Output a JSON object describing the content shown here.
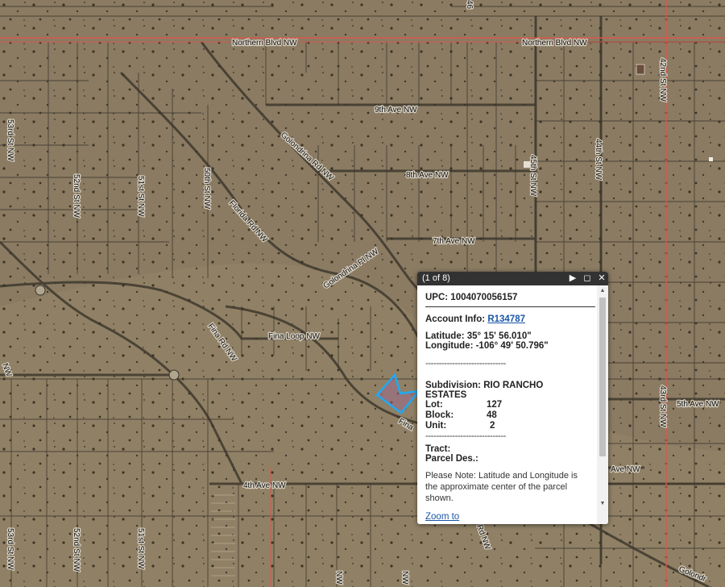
{
  "map": {
    "colors": {
      "ground": "#8a7b62",
      "grid": "#3e382e",
      "arterial": "#d9574d",
      "parcel": "#22a8f0"
    },
    "roads": {
      "northern_blvd": "Northern Blvd NW",
      "northern_blvd_2": "Northern Blvd NW",
      "ave9": "9th Ave NW",
      "ave8": "8th Ave NW",
      "ave7": "7th Ave NW",
      "ave5": "5th Ave NW",
      "ave4": "4th Ave NW",
      "golondrina_rd": "Golondrina Rd NW",
      "golondrina_pl": "Golondrina Pl NW",
      "florida_rd": "Florida Rd NW",
      "fina_loop": "Fina Loop NW",
      "fina_rd": "Fina Rd NW",
      "st53": "53rd St NW",
      "st52": "52nd St NW",
      "st51": "51st St NW",
      "st50": "50th St NW",
      "st45": "45th St NW",
      "st44": "44th St NW",
      "st43": "43rd St NW",
      "st42": "42nd St NW",
      "st53_b": "53rd St NW",
      "st52_b": "52nd St NW",
      "st51_b": "51st St NW",
      "top46": "46",
      "frag_fina": "Fina",
      "frag_ave": "Ave NW",
      "frag_rd": "Rd NW",
      "frag_nw_left": "NW",
      "frag_nw_bottom": "NW",
      "frag_golondrina": "Golondr"
    }
  },
  "popup": {
    "counter": "(1 of 8)",
    "next_icon": "next-arrow-icon",
    "maximize_icon": "maximize-icon",
    "close_icon": "close-icon",
    "title": "UPC: 1004070056157",
    "account_label": "Account Info:",
    "account_link": "R134787",
    "latitude": "Latitude: 35° 15' 56.010\"",
    "longitude": "Longitude: -106° 49' 50.796\"",
    "divider": "------------------------------",
    "subdivision_line1": "Subdivision: RIO RANCHO",
    "subdivision_line2": "ESTATES",
    "lot_label": "Lot:",
    "lot_value": "127",
    "block_label": "Block:",
    "block_value": "48",
    "unit_label": "Unit:",
    "unit_value": "2",
    "tract_label": "Tract:",
    "parcel_label": "Parcel Des.:",
    "note": "Please Note: Latitude and Longitude is the approximate center of the parcel shown.",
    "zoom_link": "Zoom to"
  }
}
